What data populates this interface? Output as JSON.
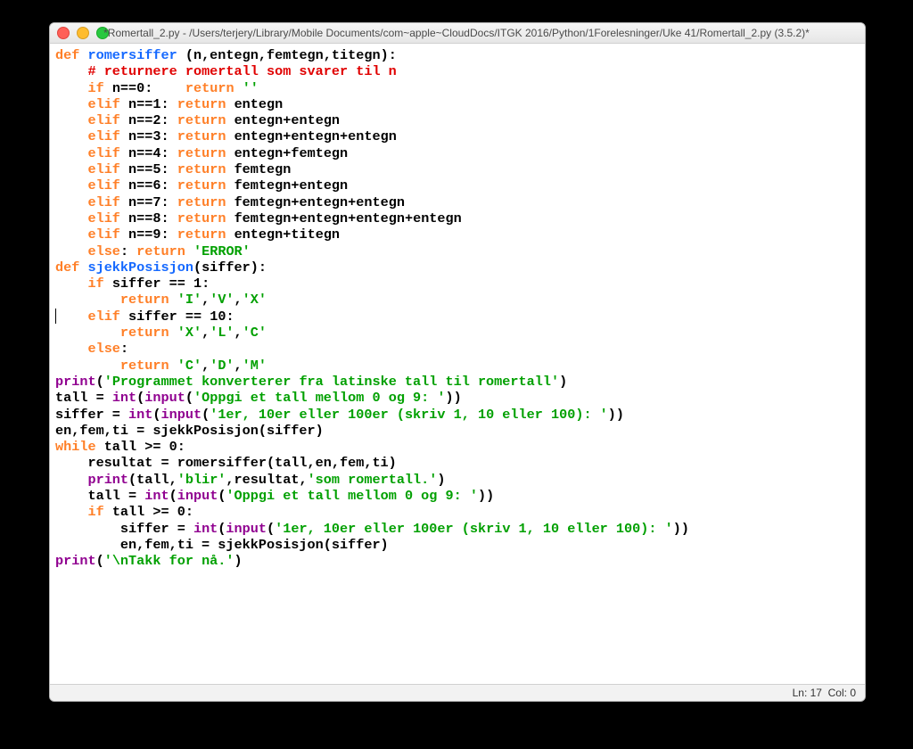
{
  "window": {
    "title": "*Romertall_2.py - /Users/terjery/Library/Mobile Documents/com~apple~CloudDocs/ITGK 2016/Python/1Forelesninger/Uke 41/Romertall_2.py (3.5.2)*"
  },
  "code": {
    "lines": [
      {
        "t": [
          [
            "kw",
            "def "
          ],
          [
            "fn",
            "romersiffer "
          ],
          [
            "op",
            "(n,entegn,femtegn,titegn):"
          ]
        ]
      },
      {
        "t": [
          [
            "op",
            "    "
          ],
          [
            "cm",
            "# returnere romertall som svarer til n"
          ]
        ]
      },
      {
        "t": [
          [
            "op",
            "    "
          ],
          [
            "kw",
            "if"
          ],
          [
            "op",
            " n=="
          ],
          [
            "op",
            "0"
          ],
          [
            "op",
            ":    "
          ],
          [
            "kw",
            "return"
          ],
          [
            "op",
            " "
          ],
          [
            "str",
            "''"
          ]
        ]
      },
      {
        "t": [
          [
            "op",
            "    "
          ],
          [
            "kw",
            "elif"
          ],
          [
            "op",
            " n=="
          ],
          [
            "op",
            "1"
          ],
          [
            "op",
            ": "
          ],
          [
            "kw",
            "return"
          ],
          [
            "op",
            " entegn"
          ]
        ]
      },
      {
        "t": [
          [
            "op",
            "    "
          ],
          [
            "kw",
            "elif"
          ],
          [
            "op",
            " n=="
          ],
          [
            "op",
            "2"
          ],
          [
            "op",
            ": "
          ],
          [
            "kw",
            "return"
          ],
          [
            "op",
            " entegn+entegn"
          ]
        ]
      },
      {
        "t": [
          [
            "op",
            "    "
          ],
          [
            "kw",
            "elif"
          ],
          [
            "op",
            " n=="
          ],
          [
            "op",
            "3"
          ],
          [
            "op",
            ": "
          ],
          [
            "kw",
            "return"
          ],
          [
            "op",
            " entegn+entegn+entegn"
          ]
        ]
      },
      {
        "t": [
          [
            "op",
            "    "
          ],
          [
            "kw",
            "elif"
          ],
          [
            "op",
            " n=="
          ],
          [
            "op",
            "4"
          ],
          [
            "op",
            ": "
          ],
          [
            "kw",
            "return"
          ],
          [
            "op",
            " entegn+femtegn"
          ]
        ]
      },
      {
        "t": [
          [
            "op",
            "    "
          ],
          [
            "kw",
            "elif"
          ],
          [
            "op",
            " n=="
          ],
          [
            "op",
            "5"
          ],
          [
            "op",
            ": "
          ],
          [
            "kw",
            "return"
          ],
          [
            "op",
            " femtegn"
          ]
        ]
      },
      {
        "t": [
          [
            "op",
            "    "
          ],
          [
            "kw",
            "elif"
          ],
          [
            "op",
            " n=="
          ],
          [
            "op",
            "6"
          ],
          [
            "op",
            ": "
          ],
          [
            "kw",
            "return"
          ],
          [
            "op",
            " femtegn+entegn"
          ]
        ]
      },
      {
        "t": [
          [
            "op",
            "    "
          ],
          [
            "kw",
            "elif"
          ],
          [
            "op",
            " n=="
          ],
          [
            "op",
            "7"
          ],
          [
            "op",
            ": "
          ],
          [
            "kw",
            "return"
          ],
          [
            "op",
            " femtegn+entegn+entegn"
          ]
        ]
      },
      {
        "t": [
          [
            "op",
            "    "
          ],
          [
            "kw",
            "elif"
          ],
          [
            "op",
            " n=="
          ],
          [
            "op",
            "8"
          ],
          [
            "op",
            ": "
          ],
          [
            "kw",
            "return"
          ],
          [
            "op",
            " femtegn+entegn+entegn+entegn"
          ]
        ]
      },
      {
        "t": [
          [
            "op",
            "    "
          ],
          [
            "kw",
            "elif"
          ],
          [
            "op",
            " n=="
          ],
          [
            "op",
            "9"
          ],
          [
            "op",
            ": "
          ],
          [
            "kw",
            "return"
          ],
          [
            "op",
            " entegn+titegn"
          ]
        ]
      },
      {
        "t": [
          [
            "op",
            "    "
          ],
          [
            "kw",
            "else"
          ],
          [
            "op",
            ": "
          ],
          [
            "kw",
            "return"
          ],
          [
            "op",
            " "
          ],
          [
            "str",
            "'ERROR'"
          ]
        ]
      },
      {
        "t": [
          [
            "op",
            ""
          ]
        ]
      },
      {
        "t": [
          [
            "kw",
            "def "
          ],
          [
            "fn",
            "sjekkPosisjon"
          ],
          [
            "op",
            "(siffer):"
          ]
        ]
      },
      {
        "t": [
          [
            "op",
            "    "
          ],
          [
            "kw",
            "if"
          ],
          [
            "op",
            " siffer == "
          ],
          [
            "op",
            "1"
          ],
          [
            "op",
            ":"
          ]
        ]
      },
      {
        "t": [
          [
            "op",
            "        "
          ],
          [
            "kw",
            "return"
          ],
          [
            "op",
            " "
          ],
          [
            "str",
            "'I'"
          ],
          [
            "op",
            ","
          ],
          [
            "str",
            "'V'"
          ],
          [
            "op",
            ","
          ],
          [
            "str",
            "'X'"
          ]
        ]
      },
      {
        "t": [
          [
            "op",
            "    "
          ],
          [
            "kw",
            "elif"
          ],
          [
            "op",
            " siffer == "
          ],
          [
            "op",
            "10"
          ],
          [
            "op",
            ":"
          ]
        ]
      },
      {
        "t": [
          [
            "op",
            "        "
          ],
          [
            "kw",
            "return"
          ],
          [
            "op",
            " "
          ],
          [
            "str",
            "'X'"
          ],
          [
            "op",
            ","
          ],
          [
            "str",
            "'L'"
          ],
          [
            "op",
            ","
          ],
          [
            "str",
            "'C'"
          ]
        ]
      },
      {
        "t": [
          [
            "op",
            "    "
          ],
          [
            "kw",
            "else"
          ],
          [
            "op",
            ":"
          ]
        ]
      },
      {
        "t": [
          [
            "op",
            "        "
          ],
          [
            "kw",
            "return"
          ],
          [
            "op",
            " "
          ],
          [
            "str",
            "'C'"
          ],
          [
            "op",
            ","
          ],
          [
            "str",
            "'D'"
          ],
          [
            "op",
            ","
          ],
          [
            "str",
            "'M'"
          ]
        ]
      },
      {
        "t": [
          [
            "op",
            ""
          ]
        ]
      },
      {
        "t": [
          [
            "bi",
            "print"
          ],
          [
            "op",
            "("
          ],
          [
            "str",
            "'Programmet konverterer fra latinske tall til romertall'"
          ],
          [
            "op",
            ")"
          ]
        ]
      },
      {
        "t": [
          [
            "op",
            "tall = "
          ],
          [
            "bi",
            "int"
          ],
          [
            "op",
            "("
          ],
          [
            "bi",
            "input"
          ],
          [
            "op",
            "("
          ],
          [
            "str",
            "'Oppgi et tall mellom 0 og 9: '"
          ],
          [
            "op",
            "))"
          ]
        ]
      },
      {
        "t": [
          [
            "op",
            "siffer = "
          ],
          [
            "bi",
            "int"
          ],
          [
            "op",
            "("
          ],
          [
            "bi",
            "input"
          ],
          [
            "op",
            "("
          ],
          [
            "str",
            "'1er, 10er eller 100er (skriv 1, 10 eller 100): '"
          ],
          [
            "op",
            "))"
          ]
        ]
      },
      {
        "t": [
          [
            "op",
            "en,fem,ti = sjekkPosisjon(siffer)"
          ]
        ]
      },
      {
        "t": [
          [
            "kw",
            "while"
          ],
          [
            "op",
            " tall >= "
          ],
          [
            "op",
            "0"
          ],
          [
            "op",
            ":"
          ]
        ]
      },
      {
        "t": [
          [
            "op",
            "    resultat = romersiffer(tall,en,fem,ti)"
          ]
        ]
      },
      {
        "t": [
          [
            "op",
            "    "
          ],
          [
            "bi",
            "print"
          ],
          [
            "op",
            "(tall,"
          ],
          [
            "str",
            "'blir'"
          ],
          [
            "op",
            ",resultat,"
          ],
          [
            "str",
            "'som romertall.'"
          ],
          [
            "op",
            ")"
          ]
        ]
      },
      {
        "t": [
          [
            "op",
            "    tall = "
          ],
          [
            "bi",
            "int"
          ],
          [
            "op",
            "("
          ],
          [
            "bi",
            "input"
          ],
          [
            "op",
            "("
          ],
          [
            "str",
            "'Oppgi et tall mellom 0 og 9: '"
          ],
          [
            "op",
            "))"
          ]
        ]
      },
      {
        "t": [
          [
            "op",
            "    "
          ],
          [
            "kw",
            "if"
          ],
          [
            "op",
            " tall >= "
          ],
          [
            "op",
            "0"
          ],
          [
            "op",
            ":"
          ]
        ]
      },
      {
        "t": [
          [
            "op",
            "        siffer = "
          ],
          [
            "bi",
            "int"
          ],
          [
            "op",
            "("
          ],
          [
            "bi",
            "input"
          ],
          [
            "op",
            "("
          ],
          [
            "str",
            "'1er, 10er eller 100er (skriv 1, 10 eller 100): '"
          ],
          [
            "op",
            "))"
          ]
        ]
      },
      {
        "t": [
          [
            "op",
            "        en,fem,ti = sjekkPosisjon(siffer)"
          ]
        ]
      },
      {
        "t": [
          [
            "op",
            ""
          ]
        ]
      },
      {
        "t": [
          [
            "bi",
            "print"
          ],
          [
            "op",
            "("
          ],
          [
            "str",
            "'\\nTakk for nå.'"
          ],
          [
            "op",
            ")"
          ]
        ]
      }
    ]
  },
  "status": {
    "ln": "Ln: 17",
    "col": "Col: 0"
  },
  "cursor": {
    "line": 17,
    "col": 0
  }
}
